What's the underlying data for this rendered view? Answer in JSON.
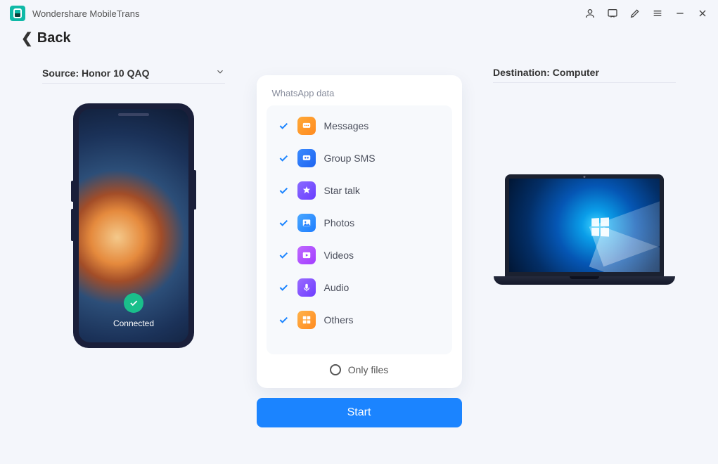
{
  "app": {
    "title": "Wondershare MobileTrans"
  },
  "nav": {
    "back_label": "Back"
  },
  "source": {
    "label": "Source: Honor 10 QAQ",
    "status": "Connected"
  },
  "destination": {
    "label": "Destination: Computer"
  },
  "panel": {
    "title": "WhatsApp data",
    "items": [
      {
        "label": "Messages",
        "icon": "messages-icon",
        "cls": "ico-msg"
      },
      {
        "label": "Group SMS",
        "icon": "group-sms-icon",
        "cls": "ico-sms"
      },
      {
        "label": "Star talk",
        "icon": "star-talk-icon",
        "cls": "ico-star"
      },
      {
        "label": "Photos",
        "icon": "photos-icon",
        "cls": "ico-photo"
      },
      {
        "label": "Videos",
        "icon": "videos-icon",
        "cls": "ico-video"
      },
      {
        "label": "Audio",
        "icon": "audio-icon",
        "cls": "ico-audio"
      },
      {
        "label": "Others",
        "icon": "others-icon",
        "cls": "ico-other"
      }
    ],
    "only_files_label": "Only files",
    "start_label": "Start"
  }
}
